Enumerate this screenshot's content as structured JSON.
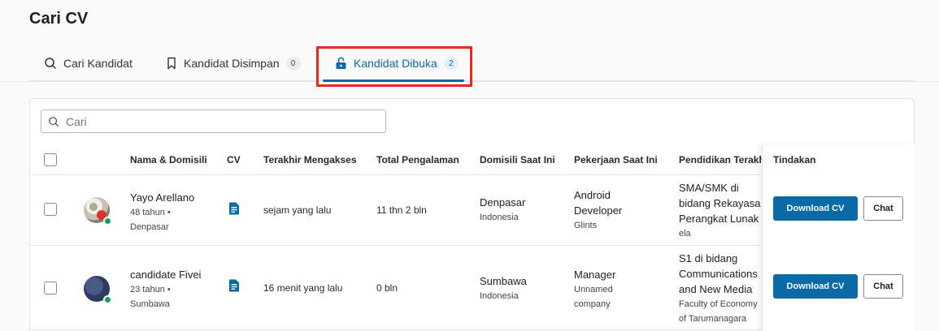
{
  "page": {
    "title": "Cari CV"
  },
  "tabs": [
    {
      "label": "Cari Kandidat",
      "icon": "search-icon"
    },
    {
      "label": "Kandidat Disimpan",
      "icon": "bookmark-icon",
      "badge": "0"
    },
    {
      "label": "Kandidat Dibuka",
      "icon": "unlock-icon",
      "badge": "2",
      "active": true
    }
  ],
  "search": {
    "placeholder": "Cari",
    "value": ""
  },
  "table": {
    "headers": {
      "name": "Nama & Domisili",
      "cv": "CV",
      "last_access": "Terakhir Mengakses",
      "experience": "Total Pengalaman",
      "domicile": "Domisili Saat Ini",
      "job": "Pekerjaan Saat Ini",
      "education": "Pendidikan Terakhir",
      "actions": "Tindakan"
    },
    "rows": [
      {
        "name": "Yayo Arellano",
        "age_line": "48 tahun •",
        "city": "Denpasar",
        "last_access": "sejam yang lalu",
        "experience": "11 thn 2 bln",
        "domicile_city": "Denpasar",
        "domicile_country": "Indonesia",
        "job_line1": "Android",
        "job_line2": "Developer",
        "company": "Glints",
        "edu_line1": "SMA/SMK di",
        "edu_line2": "bidang Rekayasa",
        "edu_line3": "Perangkat Lunak",
        "school": "ela"
      },
      {
        "name": "candidate Fivei",
        "age_line": "23 tahun •",
        "city": "Sumbawa",
        "last_access": "16 menit yang lalu",
        "experience": "0 bln",
        "domicile_city": "Sumbawa",
        "domicile_country": "Indonesia",
        "job_line1": "Manager",
        "company_line1": "Unnamed",
        "company_line2": "company",
        "edu_line1": "S1 di bidang",
        "edu_line2": "Communications",
        "edu_line3": "and New Media",
        "school_line1": "Faculty of Economy",
        "school_line2": "of Tarumanagara"
      }
    ]
  },
  "actions": {
    "download_label": "Download CV",
    "chat_label": "Chat"
  },
  "colors": {
    "primary": "#0a6aa8",
    "highlight": "#e8281b",
    "online": "#18a058"
  }
}
